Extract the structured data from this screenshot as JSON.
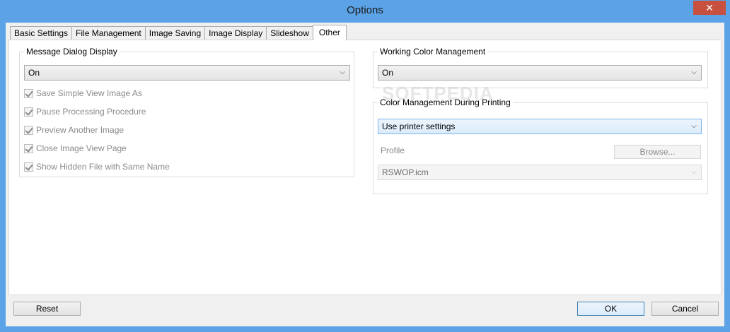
{
  "window": {
    "title": "Options",
    "close_glyph": "✕"
  },
  "tabs": [
    {
      "label": "Basic Settings"
    },
    {
      "label": "File Management"
    },
    {
      "label": "Image Saving"
    },
    {
      "label": "Image Display"
    },
    {
      "label": "Slideshow"
    },
    {
      "label": "Other"
    }
  ],
  "message_dialog": {
    "title": "Message Dialog Display",
    "value": "On",
    "checkboxes": [
      {
        "label": "Save Simple View Image As",
        "checked": true
      },
      {
        "label": "Pause Processing Procedure",
        "checked": true
      },
      {
        "label": "Preview Another Image",
        "checked": true
      },
      {
        "label": "Close Image View Page",
        "checked": true
      },
      {
        "label": "Show Hidden File with Same Name",
        "checked": true
      }
    ]
  },
  "working_color": {
    "title": "Working Color Management",
    "value": "On"
  },
  "printing_color": {
    "title": "Color Management During Printing",
    "value": "Use printer settings",
    "profile_label": "Profile",
    "browse_label": "Browse...",
    "profile_value": "RSWOP.icm"
  },
  "watermark": "SOFTPEDIA",
  "footer": {
    "reset_label": "Reset",
    "ok_label": "OK",
    "cancel_label": "Cancel"
  },
  "icons": {
    "dropdown": "chevron-down-icon",
    "close": "close-icon",
    "check": "checkmark-icon"
  },
  "colors": {
    "titlebar": "#5ba2e6",
    "close": "#c7503f",
    "focus_border": "#7eb4ea"
  }
}
